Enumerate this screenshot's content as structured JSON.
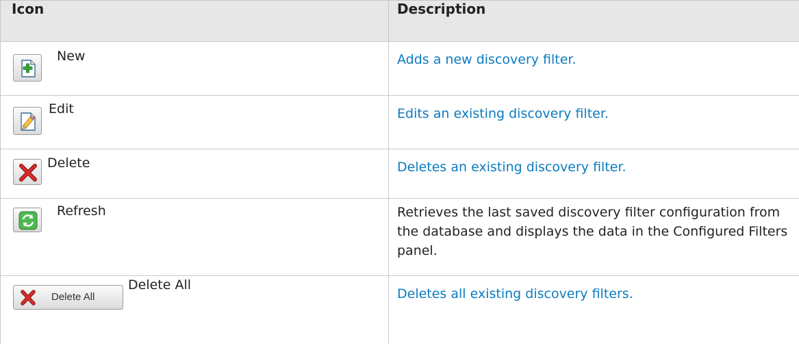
{
  "header": {
    "icon_col": "Icon",
    "desc_col": "Description"
  },
  "rows": [
    {
      "label": "New",
      "icon": "new-doc-icon",
      "description": "Adds a new discovery filter."
    },
    {
      "label": "Edit",
      "icon": "edit-doc-icon",
      "description": "Edits an existing discovery filter."
    },
    {
      "label": "Delete",
      "icon": "delete-x-icon",
      "description": "Deletes an existing discovery filter."
    },
    {
      "label": "Refresh",
      "icon": "refresh-icon",
      "description": "Retrieves the last saved discovery filter configuration from the database and displays the data in the Configured Filters panel."
    },
    {
      "label": "Delete All",
      "icon": "delete-all-icon",
      "button_text": "Delete All",
      "description": "Deletes all existing discovery filters."
    }
  ],
  "colors": {
    "link": "#0b7bbf",
    "header_bg": "#e7e7e7",
    "border": "#c8c8c8"
  }
}
